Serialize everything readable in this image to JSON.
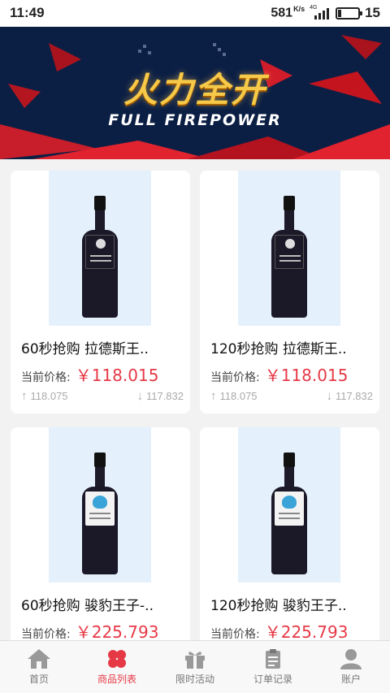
{
  "status_bar": {
    "time": "11:49",
    "net_speed": "581",
    "net_unit": "K/s",
    "network_type": "4G",
    "signal_icon": "signal-bars-icon",
    "battery_icon": "battery-icon",
    "battery_level": "15",
    "battery_fraction": 0.15
  },
  "banner": {
    "title": "火力全开",
    "subtitle": "FULL FIREPOWER",
    "accent_color": "#e0232f",
    "background_color": "#0b1f45"
  },
  "products": [
    {
      "title": "60秒抢购 拉德斯王..",
      "price_label": "当前价格:",
      "price": "￥118.015",
      "high": "118.075",
      "low": "117.832",
      "label_style": "dark"
    },
    {
      "title": "120秒抢购 拉德斯王..",
      "price_label": "当前价格:",
      "price": "￥118.015",
      "high": "118.075",
      "low": "117.832",
      "label_style": "dark"
    },
    {
      "title": "60秒抢购 骏豹王子-..",
      "price_label": "当前价格:",
      "price": "￥225.793",
      "label_style": "light"
    },
    {
      "title": "120秒抢购 骏豹王子..",
      "price_label": "当前价格:",
      "price": "￥225.793",
      "label_style": "light"
    }
  ],
  "tabbar": {
    "tabs": [
      {
        "label": "首页",
        "icon": "home-icon",
        "active": false
      },
      {
        "label": "商品列表",
        "icon": "clover-icon",
        "active": true
      },
      {
        "label": "限时活动",
        "icon": "gift-icon",
        "active": false
      },
      {
        "label": "订单记录",
        "icon": "clipboard-icon",
        "active": false
      },
      {
        "label": "账户",
        "icon": "user-icon",
        "active": false
      }
    ],
    "active_color": "#e63946",
    "inactive_color": "#777777"
  }
}
